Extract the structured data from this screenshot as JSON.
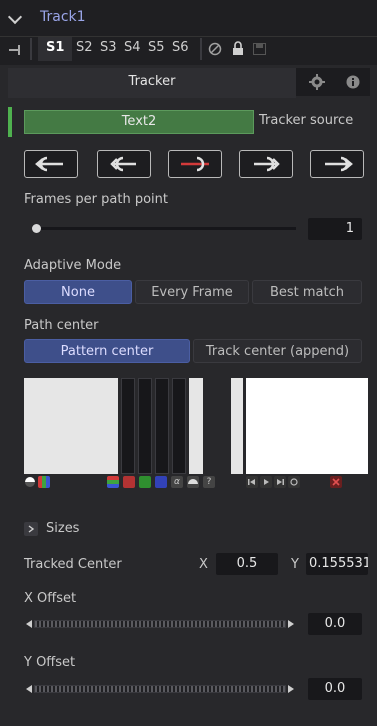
{
  "header": {
    "title": "Track1"
  },
  "slots": [
    "S1",
    "S2",
    "S3",
    "S4",
    "S5",
    "S6"
  ],
  "tabs": {
    "active": "Tracker",
    "icons": [
      "gear-icon",
      "info-icon"
    ]
  },
  "tracker_source": {
    "value": "Text2",
    "label": "Tracker source"
  },
  "track_buttons": [
    "track-reverse-icon",
    "track-reverse-frame-icon",
    "stop-track-icon",
    "track-forward-frame-icon",
    "track-forward-icon"
  ],
  "frames_per_path_point": {
    "label": "Frames per path point",
    "value": "1",
    "fraction": 0.0
  },
  "adaptive_mode": {
    "label": "Adaptive Mode",
    "options": [
      "None",
      "Every Frame",
      "Best match"
    ],
    "selected": "None"
  },
  "path_center": {
    "label": "Path center",
    "options": [
      "Pattern center",
      "Track center (append)"
    ],
    "selected": "Pattern center"
  },
  "sizes": {
    "label": "Sizes"
  },
  "tracked_center": {
    "label": "Tracked Center",
    "x_label": "X",
    "x_value": "0.5",
    "y_label": "Y",
    "y_value": "0.155531"
  },
  "x_offset": {
    "label": "X Offset",
    "value": "0.0"
  },
  "y_offset": {
    "label": "Y Offset",
    "value": "0.0"
  },
  "colors": {
    "accent_blue": "#3e4f8a",
    "green": "#447a44",
    "red": "#d23a3a"
  }
}
